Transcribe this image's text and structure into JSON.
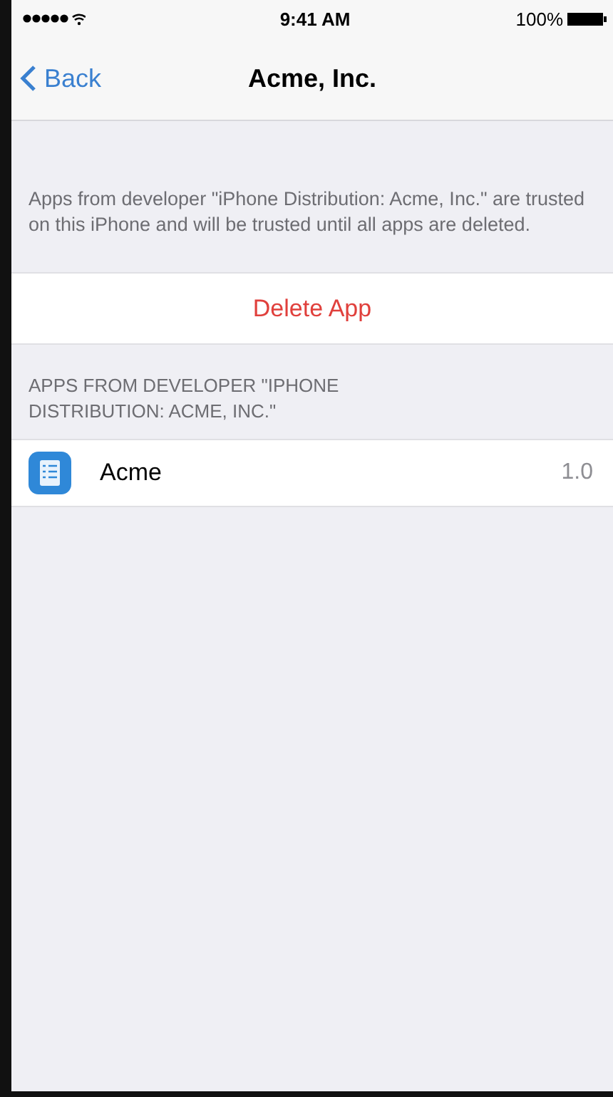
{
  "status_bar": {
    "time": "9:41 AM",
    "battery": "100%"
  },
  "nav": {
    "back": "Back",
    "title": "Acme, Inc."
  },
  "description": "Apps from developer \"iPhone Distribution: Acme, Inc.\" are trusted on this iPhone and will be trusted until all apps are deleted.",
  "delete_button": "Delete App",
  "section_header": "APPS FROM DEVELOPER \"IPHONE DISTRIBUTION: ACME, INC.\"",
  "apps": [
    {
      "name": "Acme",
      "version": "1.0"
    }
  ]
}
